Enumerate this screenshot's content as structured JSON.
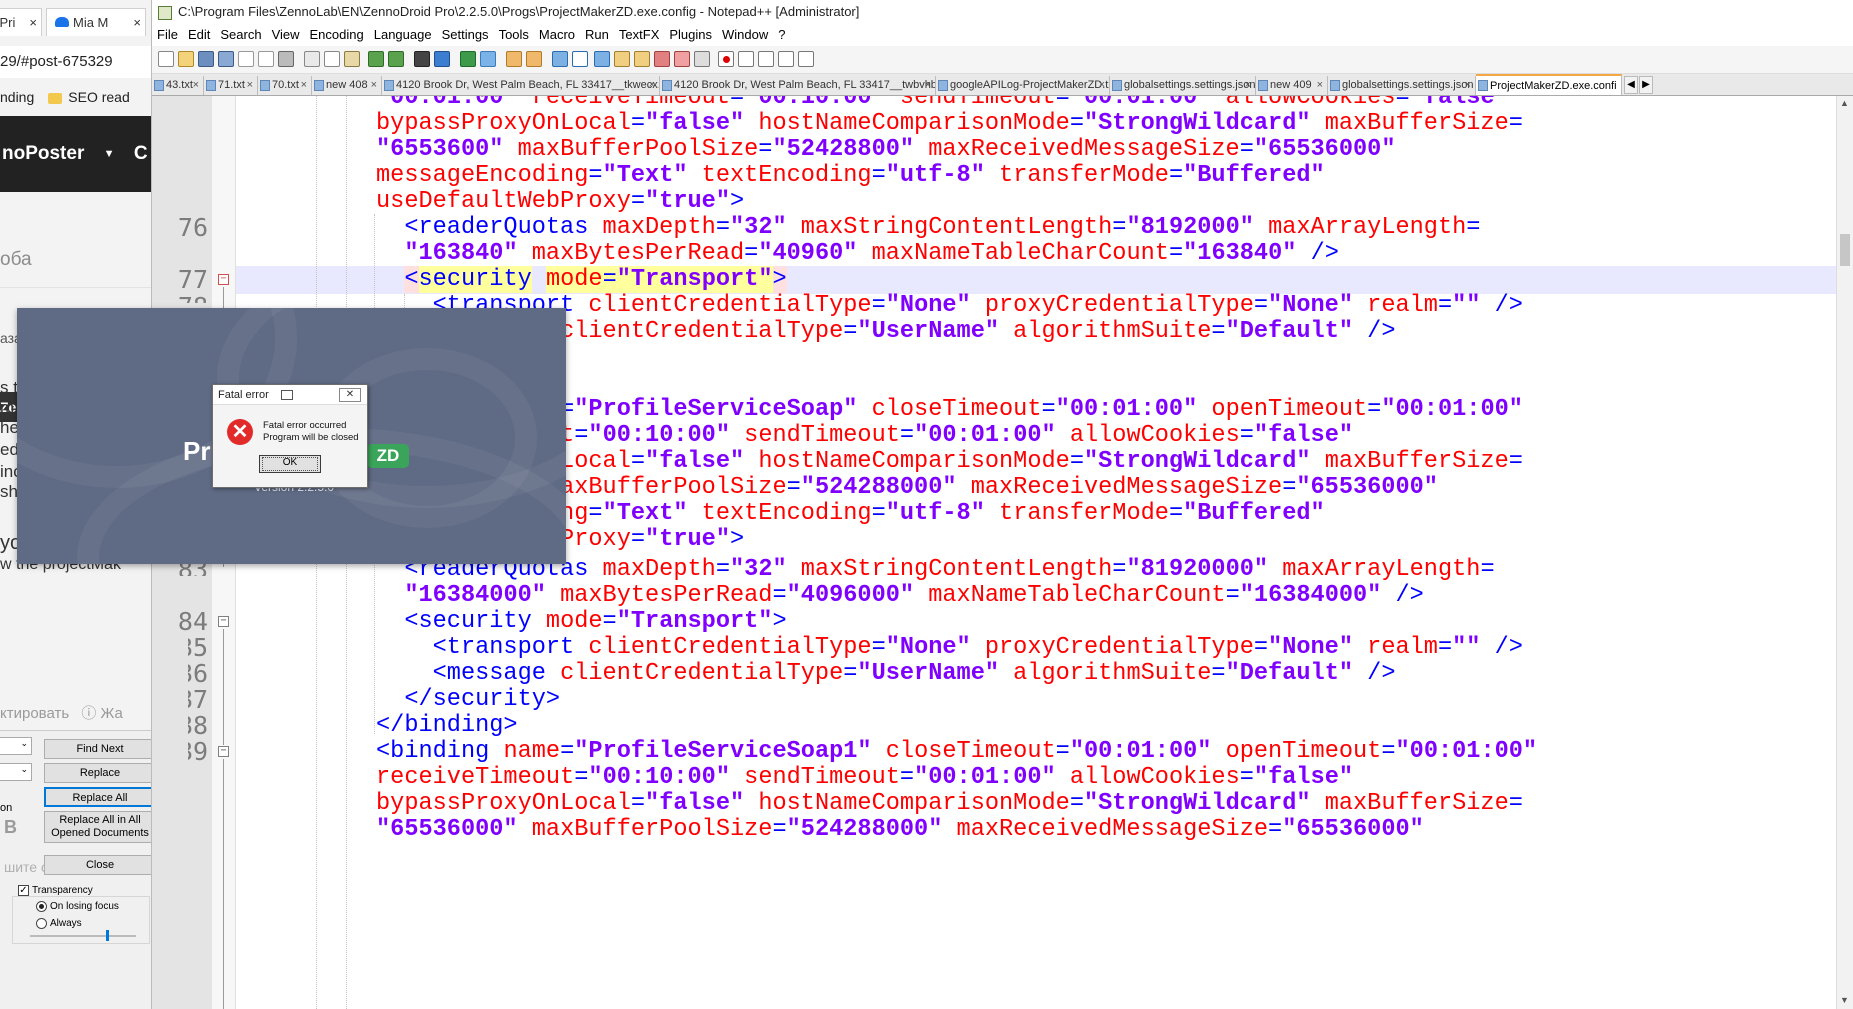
{
  "browser": {
    "tabs": [
      {
        "label": "yPri",
        "close": "×"
      },
      {
        "label": "Mia M",
        "close": "×"
      }
    ],
    "url": "29/#post-675329",
    "bookmarks": {
      "left_fragment": "nding",
      "folder_label": "SEO read"
    },
    "site_name": "noPoster",
    "site_name_tail": "C",
    "search_placeholder": "оба",
    "back_link": "азад",
    "chat_label": "Ze",
    "fragments": [
      "s th",
      "m",
      "he",
      "edi",
      "ino",
      "sho"
    ],
    "post_fragment": "yo",
    "post_fragment2": "w the projectMak",
    "edit_link": "ктировать",
    "complain_link": "Жа"
  },
  "find_panel": {
    "buttons": {
      "find_next": "Find Next",
      "replace": "Replace",
      "replace_all": "Replace All",
      "replace_all_opened": "Replace All in All Opened Documents",
      "close": "Close"
    },
    "option_fragment": "on",
    "bold_letter": "B",
    "placeholder_fragment": "шите ответ...",
    "transparency_label": "Transparency",
    "transparency_checked": true,
    "radio_on_losing_focus": "On losing focus",
    "radio_always": "Always",
    "selected_radio": "On losing focus"
  },
  "npp": {
    "title": "C:\\Program Files\\ZennoLab\\EN\\ZennoDroid Pro\\2.2.5.0\\Progs\\ProjectMakerZD.exe.config - Notepad++ [Administrator]",
    "menu": [
      "File",
      "Edit",
      "Search",
      "View",
      "Encoding",
      "Language",
      "Settings",
      "Tools",
      "Macro",
      "Run",
      "TextFX",
      "Plugins",
      "Window",
      "?"
    ],
    "tabs": [
      "43.txt",
      "71.txt",
      "70.txt",
      "new 408",
      "4120 Brook Dr, West Palm Beach, FL 33417__tkwecx.txt",
      "4120 Brook Dr, West Palm Beach, FL 33417__twbvhb.txt",
      "googleAPILog-ProjectMakerZD.txt",
      "globalsettings.settings.json",
      "new 409",
      "globalsettings.settings.json",
      "ProjectMakerZD.exe.confi"
    ],
    "tab_close": "×",
    "active_tab_index": 10
  },
  "editor": {
    "line_numbers": [
      "76",
      "77",
      "78",
      "83",
      "84",
      "85",
      "86",
      "87",
      "88",
      "89"
    ]
  },
  "splash": {
    "title": "Pr",
    "badge": "ZD",
    "version": "Version 2.2.5.0"
  },
  "dialog": {
    "title": "Fatal error",
    "close_glyph": "✕",
    "message_line1": "Fatal error occurred",
    "message_line2": "Program will be closed",
    "ok_label": "OK"
  }
}
